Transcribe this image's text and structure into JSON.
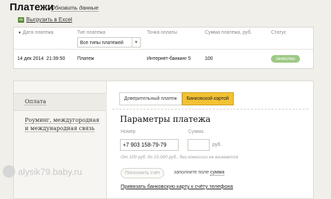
{
  "header": {
    "title": "Платежи",
    "refresh_label": "Обновить данные",
    "refresh_icon": "refresh-icon",
    "export_label": "Выгрузить в Excel",
    "export_icon": "excel-icon"
  },
  "table": {
    "columns": [
      "Дата платежа",
      "Тип платежа",
      "Точка оплаты",
      "Сумма платежа, руб.",
      "Статус"
    ],
    "type_filter_value": "Все типы платежей",
    "rows": [
      {
        "date": "14 дек 2014",
        "time": "21:39:50",
        "type": "Платеж",
        "point": "Интернет-банкинг 5",
        "amount": "100",
        "status": "зачислен"
      }
    ]
  },
  "colors": {
    "active_tab": "#f3c233",
    "status_ok": "#9ec985"
  },
  "payment": {
    "nav": {
      "item1": "Оплата",
      "item2_line1": "Роуминг, междугородная",
      "item2_line2": "и международная связь"
    },
    "tabs": {
      "trust": "Доверительный платеж",
      "card": "Банковской картой"
    },
    "section_title": "Параметры платежа",
    "number_label": "Номер",
    "number_value": "+7 903 158-79-79",
    "sum_label": "Сумма",
    "sum_value": "",
    "currency": "руб.",
    "hint": "От 100 руб. до 15.000 руб., без комиссии не взимается",
    "fill_button": "Пополнить счёт",
    "fill_note_prefix": "заполните поле",
    "fill_note_link": "сумма",
    "bind_card_link": "Привязать банковскую карту к счёту телефона"
  },
  "watermark": "alysik79.baby.ru"
}
